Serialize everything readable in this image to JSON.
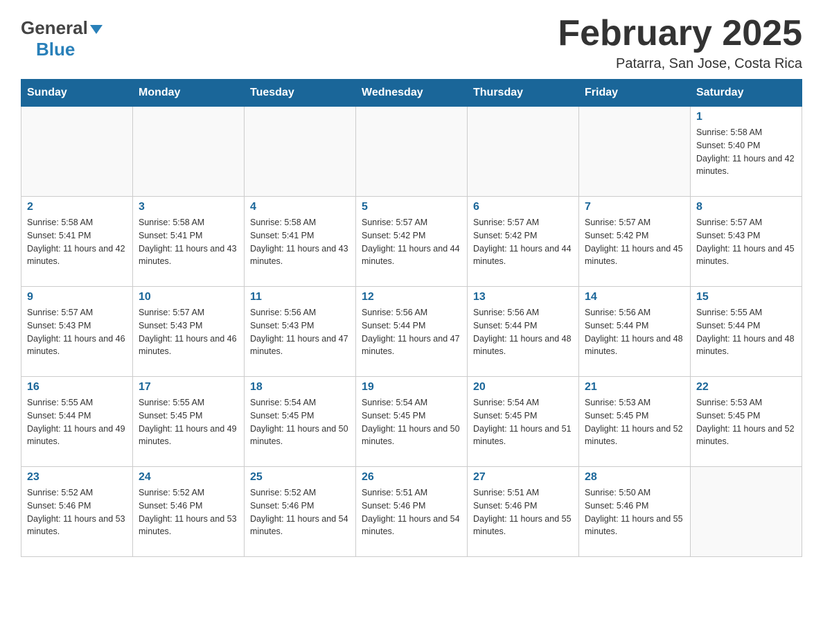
{
  "header": {
    "month_year": "February 2025",
    "location": "Patarra, San Jose, Costa Rica",
    "logo_general": "General",
    "logo_blue": "Blue"
  },
  "weekdays": [
    "Sunday",
    "Monday",
    "Tuesday",
    "Wednesday",
    "Thursday",
    "Friday",
    "Saturday"
  ],
  "weeks": [
    [
      {
        "day": "",
        "sunrise": "",
        "sunset": "",
        "daylight": ""
      },
      {
        "day": "",
        "sunrise": "",
        "sunset": "",
        "daylight": ""
      },
      {
        "day": "",
        "sunrise": "",
        "sunset": "",
        "daylight": ""
      },
      {
        "day": "",
        "sunrise": "",
        "sunset": "",
        "daylight": ""
      },
      {
        "day": "",
        "sunrise": "",
        "sunset": "",
        "daylight": ""
      },
      {
        "day": "",
        "sunrise": "",
        "sunset": "",
        "daylight": ""
      },
      {
        "day": "1",
        "sunrise": "Sunrise: 5:58 AM",
        "sunset": "Sunset: 5:40 PM",
        "daylight": "Daylight: 11 hours and 42 minutes."
      }
    ],
    [
      {
        "day": "2",
        "sunrise": "Sunrise: 5:58 AM",
        "sunset": "Sunset: 5:41 PM",
        "daylight": "Daylight: 11 hours and 42 minutes."
      },
      {
        "day": "3",
        "sunrise": "Sunrise: 5:58 AM",
        "sunset": "Sunset: 5:41 PM",
        "daylight": "Daylight: 11 hours and 43 minutes."
      },
      {
        "day": "4",
        "sunrise": "Sunrise: 5:58 AM",
        "sunset": "Sunset: 5:41 PM",
        "daylight": "Daylight: 11 hours and 43 minutes."
      },
      {
        "day": "5",
        "sunrise": "Sunrise: 5:57 AM",
        "sunset": "Sunset: 5:42 PM",
        "daylight": "Daylight: 11 hours and 44 minutes."
      },
      {
        "day": "6",
        "sunrise": "Sunrise: 5:57 AM",
        "sunset": "Sunset: 5:42 PM",
        "daylight": "Daylight: 11 hours and 44 minutes."
      },
      {
        "day": "7",
        "sunrise": "Sunrise: 5:57 AM",
        "sunset": "Sunset: 5:42 PM",
        "daylight": "Daylight: 11 hours and 45 minutes."
      },
      {
        "day": "8",
        "sunrise": "Sunrise: 5:57 AM",
        "sunset": "Sunset: 5:43 PM",
        "daylight": "Daylight: 11 hours and 45 minutes."
      }
    ],
    [
      {
        "day": "9",
        "sunrise": "Sunrise: 5:57 AM",
        "sunset": "Sunset: 5:43 PM",
        "daylight": "Daylight: 11 hours and 46 minutes."
      },
      {
        "day": "10",
        "sunrise": "Sunrise: 5:57 AM",
        "sunset": "Sunset: 5:43 PM",
        "daylight": "Daylight: 11 hours and 46 minutes."
      },
      {
        "day": "11",
        "sunrise": "Sunrise: 5:56 AM",
        "sunset": "Sunset: 5:43 PM",
        "daylight": "Daylight: 11 hours and 47 minutes."
      },
      {
        "day": "12",
        "sunrise": "Sunrise: 5:56 AM",
        "sunset": "Sunset: 5:44 PM",
        "daylight": "Daylight: 11 hours and 47 minutes."
      },
      {
        "day": "13",
        "sunrise": "Sunrise: 5:56 AM",
        "sunset": "Sunset: 5:44 PM",
        "daylight": "Daylight: 11 hours and 48 minutes."
      },
      {
        "day": "14",
        "sunrise": "Sunrise: 5:56 AM",
        "sunset": "Sunset: 5:44 PM",
        "daylight": "Daylight: 11 hours and 48 minutes."
      },
      {
        "day": "15",
        "sunrise": "Sunrise: 5:55 AM",
        "sunset": "Sunset: 5:44 PM",
        "daylight": "Daylight: 11 hours and 48 minutes."
      }
    ],
    [
      {
        "day": "16",
        "sunrise": "Sunrise: 5:55 AM",
        "sunset": "Sunset: 5:44 PM",
        "daylight": "Daylight: 11 hours and 49 minutes."
      },
      {
        "day": "17",
        "sunrise": "Sunrise: 5:55 AM",
        "sunset": "Sunset: 5:45 PM",
        "daylight": "Daylight: 11 hours and 49 minutes."
      },
      {
        "day": "18",
        "sunrise": "Sunrise: 5:54 AM",
        "sunset": "Sunset: 5:45 PM",
        "daylight": "Daylight: 11 hours and 50 minutes."
      },
      {
        "day": "19",
        "sunrise": "Sunrise: 5:54 AM",
        "sunset": "Sunset: 5:45 PM",
        "daylight": "Daylight: 11 hours and 50 minutes."
      },
      {
        "day": "20",
        "sunrise": "Sunrise: 5:54 AM",
        "sunset": "Sunset: 5:45 PM",
        "daylight": "Daylight: 11 hours and 51 minutes."
      },
      {
        "day": "21",
        "sunrise": "Sunrise: 5:53 AM",
        "sunset": "Sunset: 5:45 PM",
        "daylight": "Daylight: 11 hours and 52 minutes."
      },
      {
        "day": "22",
        "sunrise": "Sunrise: 5:53 AM",
        "sunset": "Sunset: 5:45 PM",
        "daylight": "Daylight: 11 hours and 52 minutes."
      }
    ],
    [
      {
        "day": "23",
        "sunrise": "Sunrise: 5:52 AM",
        "sunset": "Sunset: 5:46 PM",
        "daylight": "Daylight: 11 hours and 53 minutes."
      },
      {
        "day": "24",
        "sunrise": "Sunrise: 5:52 AM",
        "sunset": "Sunset: 5:46 PM",
        "daylight": "Daylight: 11 hours and 53 minutes."
      },
      {
        "day": "25",
        "sunrise": "Sunrise: 5:52 AM",
        "sunset": "Sunset: 5:46 PM",
        "daylight": "Daylight: 11 hours and 54 minutes."
      },
      {
        "day": "26",
        "sunrise": "Sunrise: 5:51 AM",
        "sunset": "Sunset: 5:46 PM",
        "daylight": "Daylight: 11 hours and 54 minutes."
      },
      {
        "day": "27",
        "sunrise": "Sunrise: 5:51 AM",
        "sunset": "Sunset: 5:46 PM",
        "daylight": "Daylight: 11 hours and 55 minutes."
      },
      {
        "day": "28",
        "sunrise": "Sunrise: 5:50 AM",
        "sunset": "Sunset: 5:46 PM",
        "daylight": "Daylight: 11 hours and 55 minutes."
      },
      {
        "day": "",
        "sunrise": "",
        "sunset": "",
        "daylight": ""
      }
    ]
  ]
}
